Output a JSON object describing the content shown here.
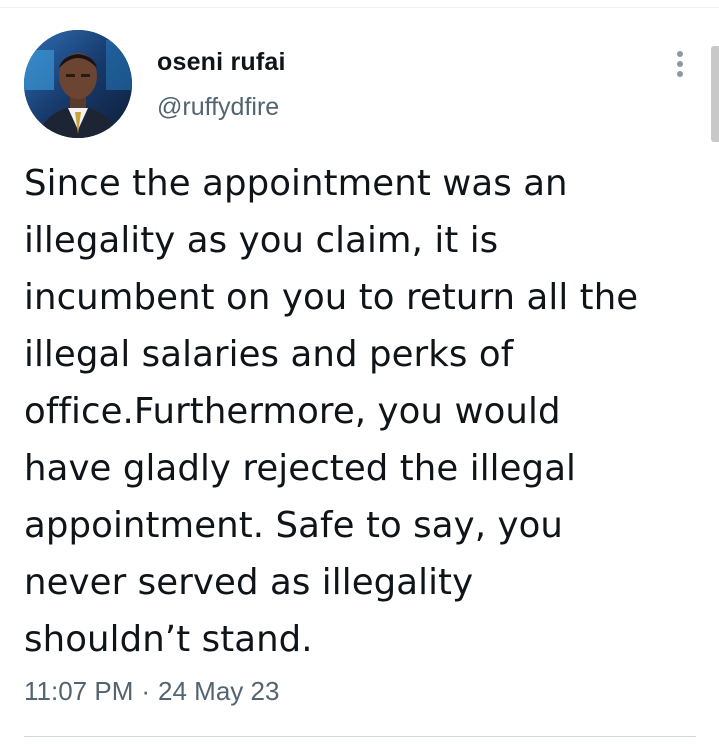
{
  "tweet": {
    "author": {
      "display_name": "oseni rufai",
      "handle": "@ruffydfire"
    },
    "text": "Since the appointment was an\nillegality as you claim, it is\nincumbent on you to return all the\nillegal salaries and perks of\noffice.Furthermore, you would\nhave gladly rejected the illegal\nappointment. Safe to say, you\nnever served as illegality\nshouldn’t stand.",
    "time": "11:07 PM",
    "separator": "·",
    "date": "24 May 23",
    "menu_icon": "more-vertical-icon"
  },
  "colors": {
    "text_primary": "#0f1419",
    "text_secondary": "#536471",
    "divider": "#cfd9de"
  }
}
